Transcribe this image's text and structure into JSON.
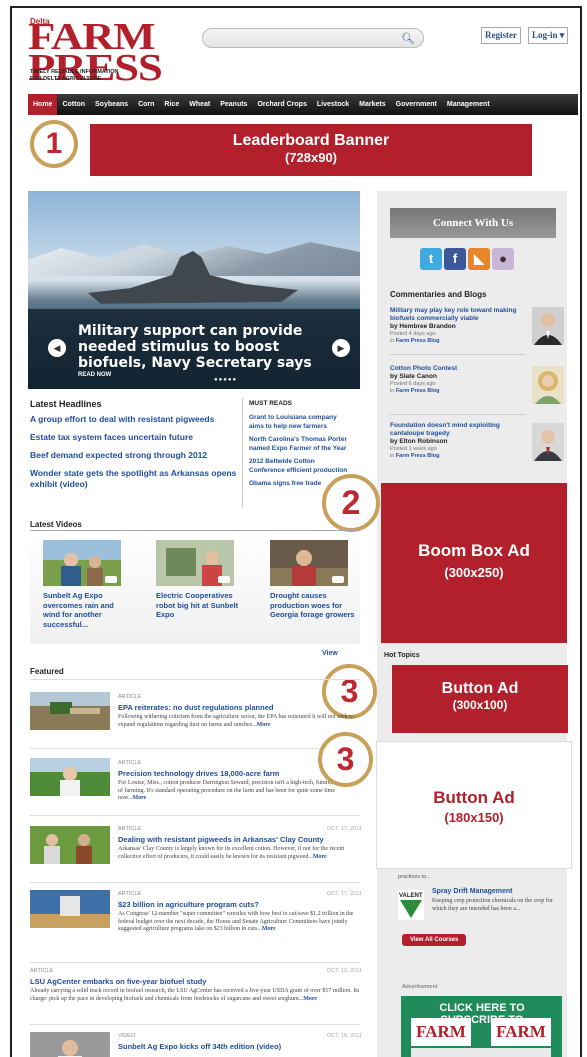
{
  "brand": {
    "pre": "Delta",
    "name_line1": "FARM",
    "name_line2": "PRESS",
    "tagline_1": "TIMELY RELIABLE INFORMATION",
    "tagline_2": "FOR DELTA AGRICULTURE"
  },
  "header": {
    "search_placeholder": "",
    "register_label": "Register",
    "login_label": "Log-in ▾"
  },
  "nav": [
    "Home",
    "Cotton",
    "Soybeans",
    "Corn",
    "Rice",
    "Wheat",
    "Peanuts",
    "Orchard Crops",
    "Livestock",
    "Markets",
    "Government",
    "Management"
  ],
  "ads": {
    "leaderboard": {
      "badge": "1",
      "title": "Leaderboard Banner",
      "size": "(728x90)"
    },
    "boombox": {
      "badge": "2",
      "title": "Boom Box Ad",
      "size": "(300x250)"
    },
    "button1": {
      "badge": "3",
      "title": "Button Ad",
      "size": "(300x100)"
    },
    "button2": {
      "badge": "3",
      "title": "Button Ad",
      "size": "(180x150)"
    }
  },
  "hero": {
    "headline": "Military support can provide needed stimulus to boost biofuels, Navy Secretary says",
    "read_now": "READ NOW",
    "prev": "◀",
    "next": "▶",
    "dots": "●●●●●"
  },
  "latest_headlines": {
    "title": "Latest Headlines",
    "items": [
      "A group effort to deal with resistant pigweeds",
      "Estate tax system faces uncertain future",
      "Beef demand expected strong through 2012",
      "Wonder state gets the spotlight as Arkansas opens exhibit (video)"
    ]
  },
  "must_reads": {
    "title": "MUST READS",
    "items": [
      "Grant to Louisiana company aims to help new farmers",
      "North Carolina's Thomas Porter named Expo Farmer of the Year",
      "2012 Beltwide Cotton Conference efficient production",
      "Obama signs free trade"
    ]
  },
  "rail": {
    "connect_title": "Connect With Us",
    "commentary_title": "Commentaries and Blogs",
    "blogs": [
      {
        "title": "Military may play key role toward making biofuels commercially viable",
        "by": "by Hembree Brandon",
        "posted": "Posted 4 days ago",
        "in_label": "in",
        "blog": "Farm Press Blog"
      },
      {
        "title": "Cotton Photo Contest",
        "by": "by Slate Canon",
        "posted": "Posted 6 days ago",
        "in_label": "in",
        "blog": "Farm Press Blog"
      },
      {
        "title": "Foundation doesn't mind exploiting cantaloupe tragedy",
        "by": "by Elton Robinson",
        "posted": "Posted 1 week ago",
        "in_label": "in",
        "blog": "Farm Press Blog"
      }
    ],
    "hot_topics": "Hot Topics",
    "practices_text": "practices to...",
    "spray_title": "Spray Drift Management",
    "spray_desc": "Keeping crop protection chemicals on the crop for which they are intended has been a...",
    "view_courses": "View All Courses",
    "advertisement": "Advertisement",
    "subscribe_text": "CLICK HERE TO SUBSCRIBE TO",
    "subscribe_logo": "FARM"
  },
  "videos": {
    "title": "Latest Videos",
    "view_all": "View",
    "items": [
      "Sunbelt Ag Expo overcomes rain and wind for another successful...",
      "Electric Cooperatives robot big hit at Sunbelt Expo",
      "Drought causes production woes for Georgia forage growers"
    ]
  },
  "featured": {
    "title": "Featured",
    "items": [
      {
        "kind": "ARTICLE",
        "date": "",
        "title": "EPA reiterates: no dust regulations planned",
        "desc": "Following withering criticism from the agriculture sector, the EPA has reiterated it will not seek to expand regulations regarding dust on farms and ranches...",
        "more": "More"
      },
      {
        "kind": "ARTICLE",
        "date": "",
        "title": "Precision technology drives 18,000-acre farm",
        "desc": "For Louise, Miss., cotton producer Darrington Seward, precision isn't a high-tech, futuristic method of farming. It's standard operating procedure on the farm and has been for quite some time now...",
        "more": "More"
      },
      {
        "kind": "ARTICLE",
        "date": "OCT. 17, 2011",
        "title": "Dealing with resistant pigweeds in Arkansas' Clay County",
        "desc": "Arkansas' Clay County is largely known for its excellent cotton. However, if not for the recent collective effort of producers, it could easily be known for its resistant pigweed...",
        "more": "More"
      },
      {
        "kind": "ARTICLE",
        "date": "OCT. 17, 2011",
        "title": "$23 billion in agriculture program cuts?",
        "desc": "As Congress' 12-member \"super committee\" wrestles with how best to cut/save $1.2 trillion in the federal budget over the next decade, the House and Senate Agriculture Committees have jointly suggested agriculture programs take on $23 billion in cuts...",
        "more": "More"
      },
      {
        "kind": "ARTICLE",
        "date": "OCT. 18, 2011",
        "title": "LSU AgCenter embarks on five-year biofuel study",
        "desc": "Already carrying a solid track record in biofuel research, the LSU AgCenter has received a five-year USDA grant of over $17 million. Its charge: pick up the pace in developing biofuels and chemicals from feedstocks of sugarcane and sweet sorghum...",
        "more": "More"
      },
      {
        "kind": "VIDEO",
        "date": "OCT. 18, 2011",
        "title": "Sunbelt Ag Expo kicks off 34th edition (video)",
        "desc": "",
        "more": ""
      }
    ]
  }
}
